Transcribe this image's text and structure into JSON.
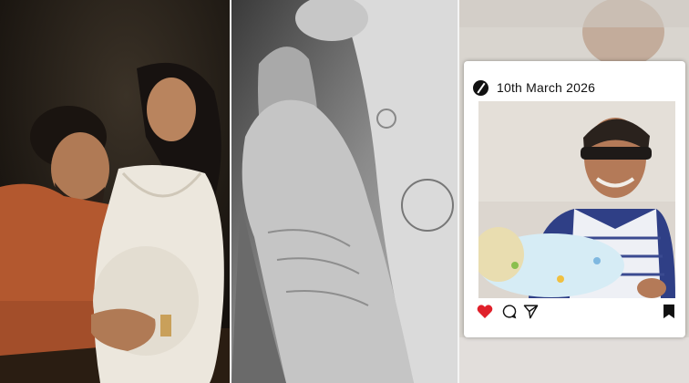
{
  "post": {
    "date": "10th March 2026",
    "icons": [
      "logo-icon",
      "heart-icon",
      "comment-icon",
      "share-icon",
      "bookmark-icon"
    ]
  },
  "colors": {
    "heart": "#e0202a",
    "card_background": "#ffffff",
    "photo_wall": "#dcd6cf"
  }
}
